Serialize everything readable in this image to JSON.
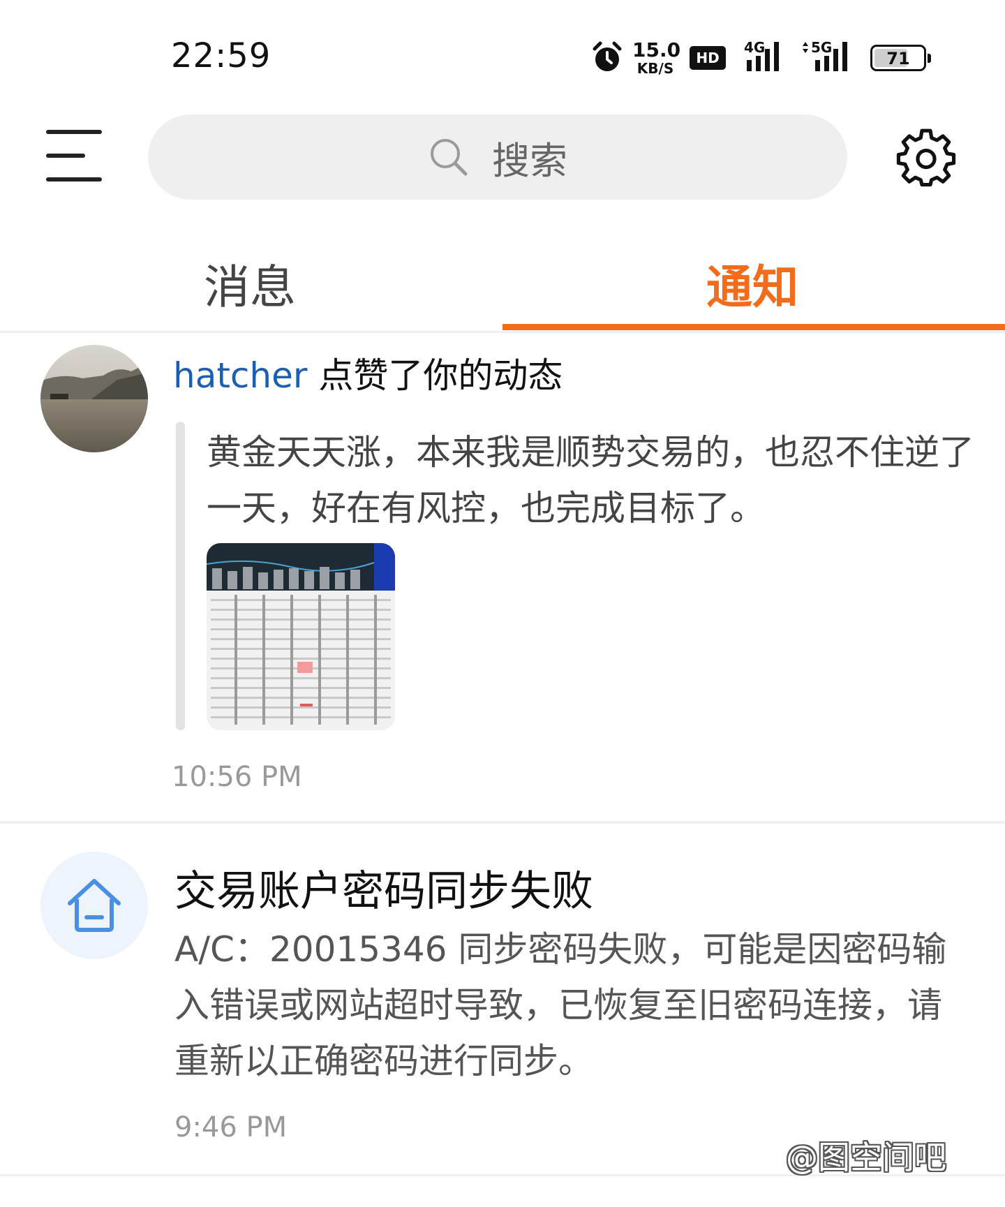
{
  "status_bar": {
    "time": "22:59",
    "net_speed_value": "15.0",
    "net_speed_unit": "KB/S",
    "hd_label": "HD",
    "signal_1": "4G",
    "signal_2": "5G",
    "battery": "71",
    "battery_level": 0.71
  },
  "header": {
    "search_placeholder": "搜索"
  },
  "tabs": [
    {
      "label": "消息",
      "active": false
    },
    {
      "label": "通知",
      "active": true
    }
  ],
  "notifications": [
    {
      "user": "hatcher",
      "action": "点赞了你的动态",
      "post_text": "黄金天天涨，本来我是顺势交易的，也忍不住逆了一天，好在有风控，也完成目标了。",
      "time": "10:56 PM"
    },
    {
      "title": "交易账户密码同步失败",
      "body": "A/C：20015346 同步密码失败，可能是因密码输入错误或网站超时导致，已恢复至旧密码连接，请重新以正确密码进行同步。",
      "time": "9:46 PM"
    }
  ],
  "watermark": "@图空间吧",
  "colors": {
    "accent": "#f26c1c",
    "link": "#1a5fb4",
    "system_icon": "#4a90e2"
  }
}
